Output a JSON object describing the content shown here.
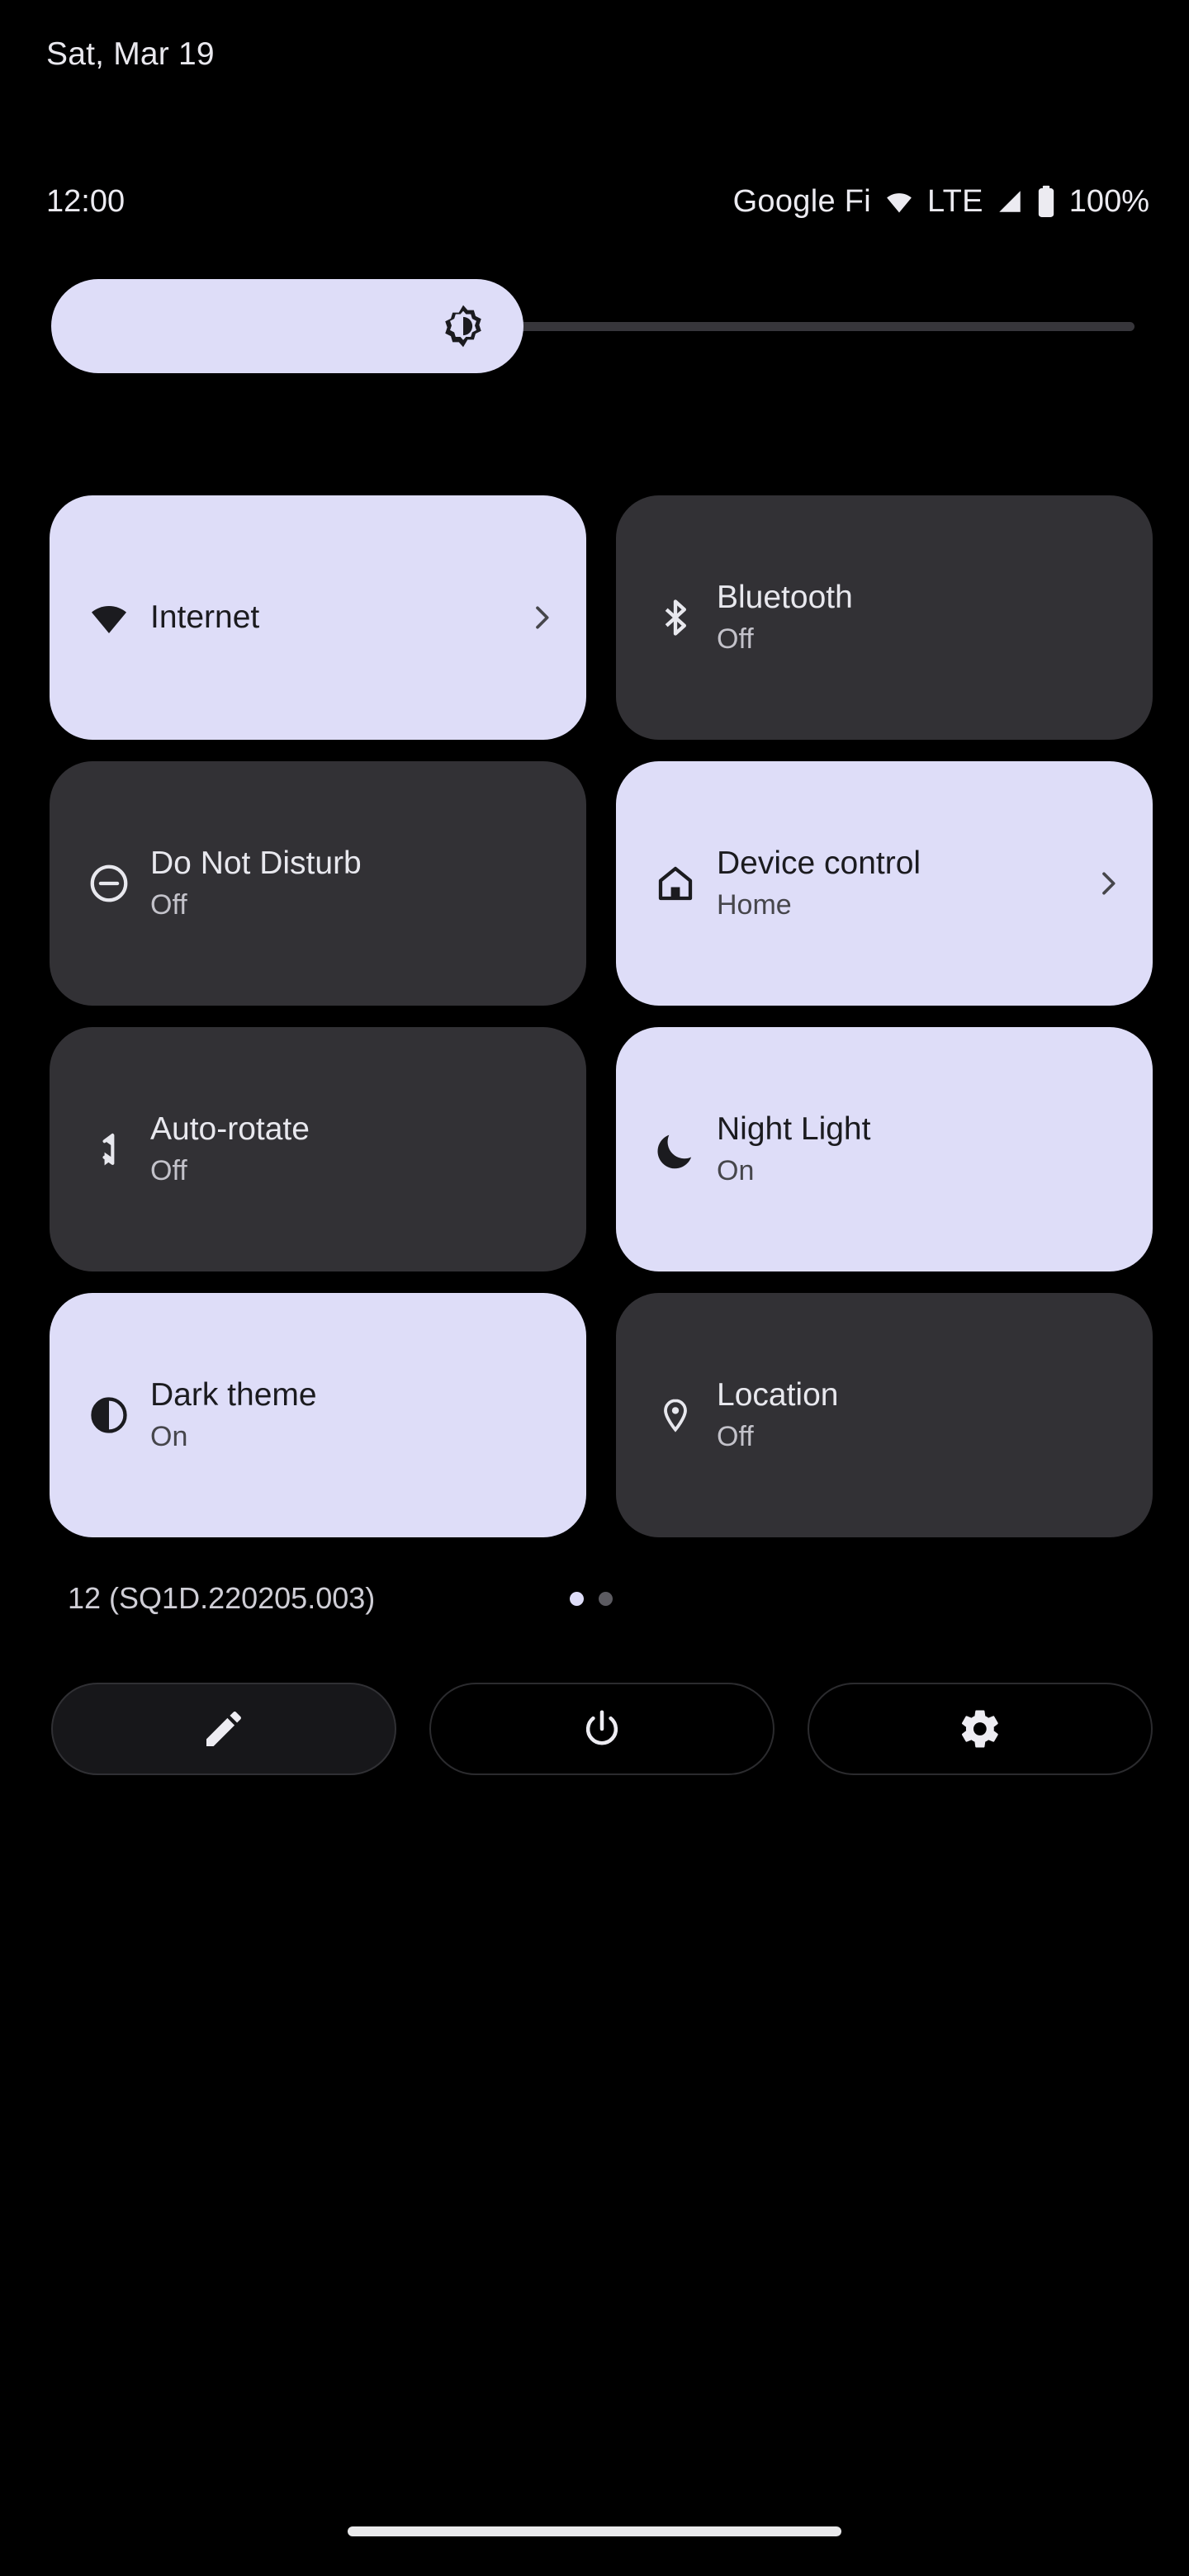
{
  "header": {
    "date": "Sat, Mar 19"
  },
  "status_bar": {
    "clock": "12:00",
    "carrier": "Google Fi",
    "wifi_icon": "wifi-icon",
    "network_type": "LTE",
    "signal_icon": "cell-signal-icon",
    "battery_icon": "battery-full-icon",
    "battery_percent": "100%"
  },
  "brightness": {
    "icon": "brightness-icon",
    "level_percent": 43,
    "label": "Brightness"
  },
  "tiles": [
    {
      "name": "internet",
      "title": "Internet",
      "subtitle": "",
      "state": "on",
      "icon": "wifi-icon",
      "has_chevron": true
    },
    {
      "name": "bluetooth",
      "title": "Bluetooth",
      "subtitle": "Off",
      "state": "off",
      "icon": "bluetooth-icon",
      "has_chevron": false
    },
    {
      "name": "do-not-disturb",
      "title": "Do Not Disturb",
      "subtitle": "Off",
      "state": "off",
      "icon": "do-not-disturb-icon",
      "has_chevron": false
    },
    {
      "name": "device-controls",
      "title": "Device control",
      "subtitle": "Home",
      "state": "on",
      "icon": "home-icon",
      "has_chevron": true
    },
    {
      "name": "auto-rotate",
      "title": "Auto-rotate",
      "subtitle": "Off",
      "state": "off",
      "icon": "auto-rotate-icon",
      "has_chevron": false
    },
    {
      "name": "night-light",
      "title": "Night Light",
      "subtitle": "On",
      "state": "on",
      "icon": "moon-icon",
      "has_chevron": false
    },
    {
      "name": "dark-theme",
      "title": "Dark theme",
      "subtitle": "On",
      "state": "on",
      "icon": "dark-theme-icon",
      "has_chevron": false
    },
    {
      "name": "location",
      "title": "Location",
      "subtitle": "Off",
      "state": "off",
      "icon": "location-pin-icon",
      "has_chevron": false
    }
  ],
  "footer": {
    "build_version": "12 (SQ1D.220205.003)",
    "page_indicator": {
      "total": 2,
      "current": 1
    },
    "buttons": [
      {
        "name": "edit-tiles",
        "icon": "pencil-icon",
        "filled": true
      },
      {
        "name": "power",
        "icon": "power-icon",
        "filled": false
      },
      {
        "name": "settings",
        "icon": "gear-icon",
        "filled": false
      }
    ]
  },
  "colors": {
    "background": "#000000",
    "tile_active": "#DEDDF8",
    "tile_inactive": "#323135",
    "text_on_active": "#1B1B1F",
    "text_on_inactive": "#E8E8EE",
    "slider_track": "#37363B"
  }
}
